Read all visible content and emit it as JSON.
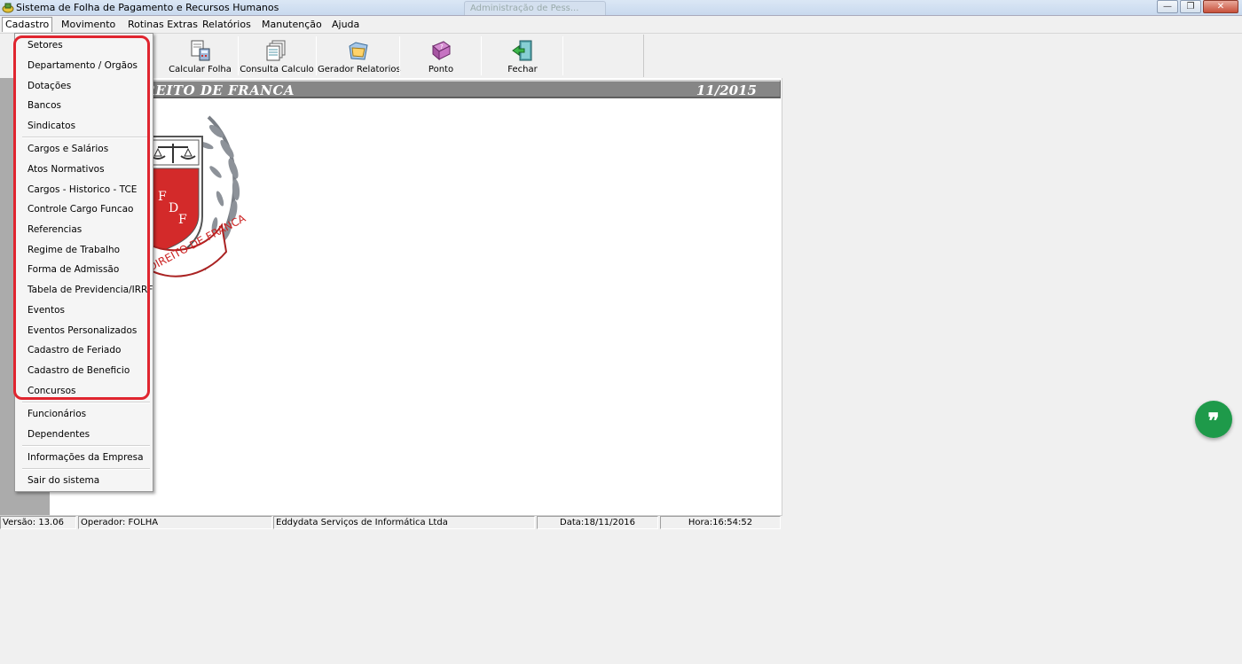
{
  "window": {
    "title": "Sistema de Folha de Pagamento e Recursos Humanos",
    "background_tab_text": "Administração de Pess..."
  },
  "menubar": {
    "items": [
      {
        "label": "Cadastro"
      },
      {
        "label": "Movimento"
      },
      {
        "label": "Rotinas Extras"
      },
      {
        "label": "Relatórios"
      },
      {
        "label": "Manutenção"
      },
      {
        "label": "Ajuda"
      }
    ]
  },
  "toolbar": {
    "buttons": [
      {
        "label": "Calcular Folha",
        "icon": "calculator-sheet-icon"
      },
      {
        "label": "Consulta Calculo",
        "icon": "stacked-pages-icon"
      },
      {
        "label": "Gerador Relatorios",
        "icon": "folder-report-icon"
      },
      {
        "label": "Ponto",
        "icon": "book-icon"
      },
      {
        "label": "Fechar",
        "icon": "exit-door-icon"
      }
    ]
  },
  "banner": {
    "title": "ADE DE DIREITO DE FRANCA",
    "period": "11/2015"
  },
  "logo": {
    "initials": [
      "F",
      "D",
      "F"
    ],
    "ribbon_text": "DIREITO DE FRANCA"
  },
  "dropdown": {
    "group1": [
      {
        "label": "Setores"
      },
      {
        "label": "Departamento / Orgãos"
      },
      {
        "label": "Dotações"
      },
      {
        "label": "Bancos"
      },
      {
        "label": "Sindicatos"
      }
    ],
    "group2": [
      {
        "label": "Cargos e Salários"
      },
      {
        "label": "Atos Normativos"
      },
      {
        "label": "Cargos - Historico - TCE"
      },
      {
        "label": "Controle Cargo Funcao"
      },
      {
        "label": "Referencias"
      },
      {
        "label": "Regime de Trabalho"
      },
      {
        "label": "Forma de Admissão"
      },
      {
        "label": "Tabela de Previdencia/IRRF"
      },
      {
        "label": "Eventos"
      },
      {
        "label": "Eventos Personalizados"
      },
      {
        "label": "Cadastro de Feriado"
      },
      {
        "label": "Cadastro de Beneficio"
      },
      {
        "label": "Concursos"
      }
    ],
    "group3": [
      {
        "label": "Funcionários"
      },
      {
        "label": "Dependentes"
      }
    ],
    "group4": [
      {
        "label": "Informações da Empresa"
      }
    ],
    "group5": [
      {
        "label": "Sair do sistema"
      }
    ]
  },
  "statusbar": {
    "version": "Versão: 13.06",
    "operator": "Operador: FOLHA",
    "company": "Eddydata Serviços de Informática Ltda",
    "date": "Data:18/11/2016",
    "time": "Hora:16:54:52"
  },
  "fab": {
    "icon": "quote-icon",
    "color": "#1e9a4a"
  },
  "colors": {
    "highlight_border": "#e0252f",
    "banner_bg": "#868686"
  }
}
